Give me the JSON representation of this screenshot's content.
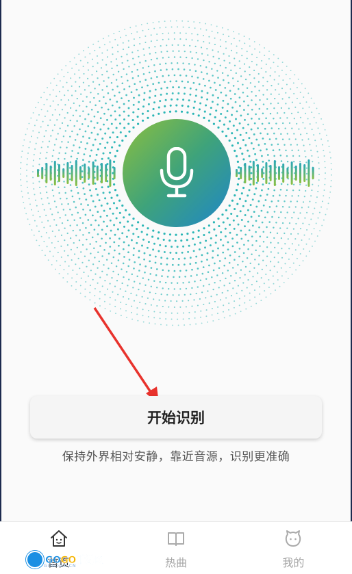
{
  "main": {
    "start_button_label": "开始识别",
    "hint_text": "保持外界相对安静，靠近音源，识别更准确"
  },
  "nav": {
    "items": [
      {
        "label": "首页",
        "icon": "home-icon",
        "active": true
      },
      {
        "label": "热曲",
        "icon": "book-icon",
        "active": false
      },
      {
        "label": "我的",
        "icon": "face-icon",
        "active": false
      }
    ]
  },
  "watermark": {
    "text_a": "GO",
    "text_b": "GO",
    "text_c": "手游网",
    "sub": "GOGOGO.CN"
  },
  "colors": {
    "accent_green": "#8cbf3f",
    "accent_blue": "#1e86c9",
    "dot_teal": "#2ab5b5",
    "arrow_red": "#e8322c"
  }
}
